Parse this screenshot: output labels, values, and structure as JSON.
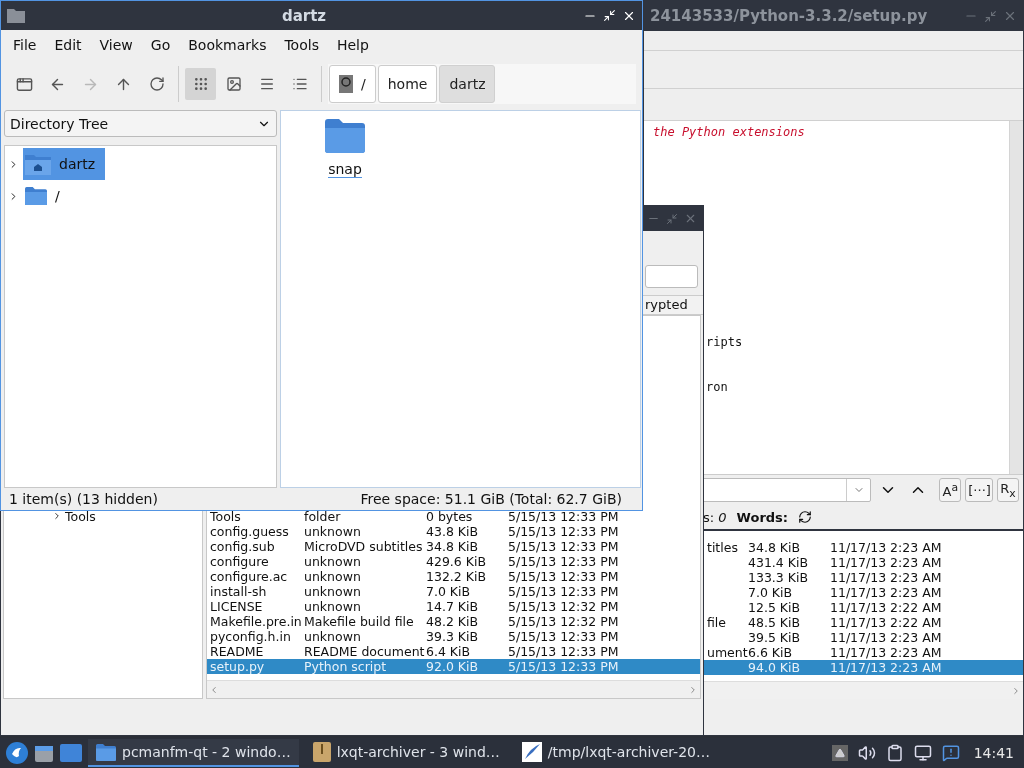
{
  "editor": {
    "title": "24143533/Python-3.3.2/setup.py",
    "code_lines": [
      {
        "kind": "comment",
        "text": "the Python extensions"
      },
      {
        "kind": "blank"
      },
      {
        "kind": "blank"
      },
      {
        "kind": "blank"
      },
      {
        "kind": "blank"
      },
      {
        "kind": "blank"
      },
      {
        "kind": "blank"
      },
      {
        "kind": "blank"
      },
      {
        "kind": "blank"
      },
      {
        "kind": "blank"
      },
      {
        "kind": "blank"
      },
      {
        "kind": "blank"
      },
      {
        "kind": "blank"
      },
      {
        "kind": "blank"
      },
      {
        "kind": "code",
        "text": "ripts"
      },
      {
        "kind": "blank"
      },
      {
        "kind": "blank"
      },
      {
        "kind": "code",
        "text": "ron"
      }
    ],
    "find_buttons": [
      "A$^{a}$",
      "[···]",
      "R$_{x}$"
    ],
    "status": {
      "lines_label": "s:",
      "lines_value": "0",
      "words_label": "Words:"
    }
  },
  "archiver_back": {
    "rows": [
      {
        "type": "titles",
        "size": "34.8 KiB",
        "modified": "11/17/13 2:23 AM",
        "selected": false
      },
      {
        "size": "431.4 KiB",
        "modified": "11/17/13 2:23 AM",
        "selected": false
      },
      {
        "size": "133.3 KiB",
        "modified": "11/17/13 2:23 AM",
        "selected": false
      },
      {
        "size": "7.0 KiB",
        "modified": "11/17/13 2:23 AM",
        "selected": false
      },
      {
        "size": "12.5 KiB",
        "modified": "11/17/13 2:22 AM",
        "selected": false
      },
      {
        "type": "file",
        "size": "48.5 KiB",
        "modified": "11/17/13 2:22 AM",
        "selected": false
      },
      {
        "size": "39.5 KiB",
        "modified": "11/17/13 2:23 AM",
        "selected": false
      },
      {
        "type": "ument",
        "size": "6.6 KiB",
        "modified": "11/17/13 2:23 AM",
        "selected": false
      },
      {
        "size": "94.0 KiB",
        "modified": "11/17/13 2:23 AM",
        "selected": true
      }
    ]
  },
  "archiver": {
    "column_header": "rypted",
    "tree_items": [
      {
        "label": "Tools"
      }
    ],
    "rows": [
      {
        "name": "Tools",
        "type": "folder",
        "size": "0 bytes",
        "modified": "5/15/13 12:33 PM",
        "selected": false
      },
      {
        "name": "config.guess",
        "type": "unknown",
        "size": "43.8 KiB",
        "modified": "5/15/13 12:33 PM",
        "selected": false
      },
      {
        "name": "config.sub",
        "type": "MicroDVD subtitles",
        "size": "34.8 KiB",
        "modified": "5/15/13 12:33 PM",
        "selected": false
      },
      {
        "name": "configure",
        "type": "unknown",
        "size": "429.6 KiB",
        "modified": "5/15/13 12:33 PM",
        "selected": false
      },
      {
        "name": "configure.ac",
        "type": "unknown",
        "size": "132.2 KiB",
        "modified": "5/15/13 12:33 PM",
        "selected": false
      },
      {
        "name": "install-sh",
        "type": "unknown",
        "size": "7.0 KiB",
        "modified": "5/15/13 12:33 PM",
        "selected": false
      },
      {
        "name": "LICENSE",
        "type": "unknown",
        "size": "14.7 KiB",
        "modified": "5/15/13 12:32 PM",
        "selected": false
      },
      {
        "name": "Makefile.pre.in",
        "type": "Makefile build file",
        "size": "48.2 KiB",
        "modified": "5/15/13 12:32 PM",
        "selected": false
      },
      {
        "name": "pyconfig.h.in",
        "type": "unknown",
        "size": "39.3 KiB",
        "modified": "5/15/13 12:33 PM",
        "selected": false
      },
      {
        "name": "README",
        "type": "README document",
        "size": "6.4 KiB",
        "modified": "5/15/13 12:33 PM",
        "selected": false
      },
      {
        "name": "setup.py",
        "type": "Python script",
        "size": "92.0 KiB",
        "modified": "5/15/13 12:33 PM",
        "selected": true
      }
    ]
  },
  "file_manager": {
    "title": "dartz",
    "menu": [
      "File",
      "Edit",
      "View",
      "Go",
      "Bookmarks",
      "Tools",
      "Help"
    ],
    "nav_buttons": [
      {
        "kind": "new-window",
        "disabled": false
      },
      {
        "kind": "back",
        "disabled": false
      },
      {
        "kind": "forward",
        "disabled": true
      },
      {
        "kind": "up",
        "disabled": false
      },
      {
        "kind": "reload",
        "disabled": false
      }
    ],
    "view_modes": [
      {
        "kind": "icon",
        "selected": true
      },
      {
        "kind": "thumbnail",
        "selected": false
      },
      {
        "kind": "compact",
        "selected": false
      },
      {
        "kind": "detailed",
        "selected": false
      }
    ],
    "path": [
      {
        "kind": "root",
        "label": "/",
        "selected": false
      },
      {
        "kind": "folder",
        "label": "home",
        "selected": false
      },
      {
        "kind": "folder",
        "label": "dartz",
        "selected": true
      }
    ],
    "side_pane_mode": "Directory Tree",
    "tree": [
      {
        "kind": "home",
        "label": "dartz",
        "selected": true
      },
      {
        "kind": "folder",
        "label": "/",
        "selected": false
      }
    ],
    "files": [
      {
        "name": "snap"
      }
    ],
    "status_left": "1 item(s) (13 hidden)",
    "status_right": "Free space: 51.1 GiB (Total: 62.7 GiB)"
  },
  "taskbar": {
    "tasks": [
      {
        "kind": "folder",
        "label": "pcmanfm-qt - 2 windo…",
        "active": true
      },
      {
        "kind": "archive",
        "label": "lxqt-archiver - 3 wind…",
        "active": false
      },
      {
        "kind": "editor",
        "label": "/tmp/lxqt-archiver-20…",
        "active": false
      }
    ],
    "clock": "14:41"
  }
}
